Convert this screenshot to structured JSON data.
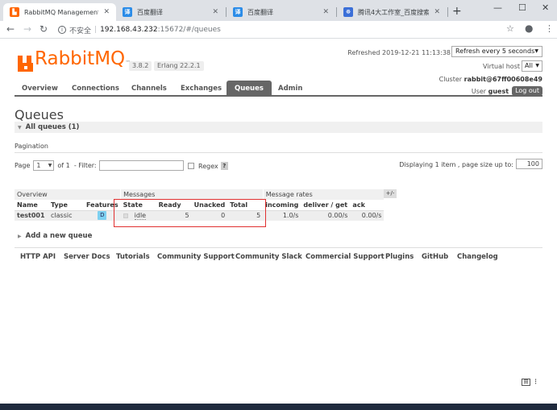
{
  "browser": {
    "tabs": [
      {
        "label": "RabbitMQ Management",
        "favicon": "rabbitmq-icon",
        "favicon_color": "#f60",
        "favicon_text": "▙",
        "active": true
      },
      {
        "label": "百度翻译",
        "favicon": "baidu-translate-icon",
        "favicon_color": "#2b8ce8",
        "favicon_text": "译",
        "active": false
      },
      {
        "label": "百度翻译",
        "favicon": "baidu-translate-icon",
        "favicon_color": "#2b8ce8",
        "favicon_text": "译",
        "active": false
      },
      {
        "label": "腾讯4大工作室_百度搜索",
        "favicon": "baidu-paw-icon",
        "favicon_color": "#3b6fd8",
        "favicon_text": "☸",
        "active": false
      }
    ],
    "url": {
      "security": "不安全",
      "host": "192.168.43.232",
      "rest": ":15672/#/queues"
    }
  },
  "header": {
    "logo_rabbit": "Rabbit",
    "logo_mq": "MQ",
    "logo_tm": "™",
    "version": "3.8.2",
    "erlang": "Erlang 22.2.1",
    "refreshed_label": "Refreshed",
    "refreshed_time": "2019-12-21 11:13:38",
    "refresh_select": "Refresh every 5 seconds",
    "vhost_label": "Virtual host",
    "vhost_value": "All",
    "cluster_label": "Cluster",
    "cluster_value": "rabbit@67ff00608e49",
    "user_label": "User",
    "user_value": "guest",
    "logout": "Log out"
  },
  "nav": {
    "items": [
      "Overview",
      "Connections",
      "Channels",
      "Exchanges",
      "Queues",
      "Admin"
    ],
    "selected": "Queues"
  },
  "main": {
    "title": "Queues",
    "all_queues": "All queues (1)",
    "pagination_label": "Pagination",
    "page_label": "Page",
    "page_value": "1",
    "of_label": "of 1",
    "filter_label": "- Filter:",
    "regex_label": "Regex",
    "help_mark": "?",
    "displaying": "Displaying 1 item , page size up to:",
    "page_size": "100",
    "plus_minus": "+/-",
    "add_queue": "Add a new queue"
  },
  "table": {
    "groups": [
      "Overview",
      "Messages",
      "Message rates"
    ],
    "headers": [
      "Name",
      "Type",
      "Features",
      "State",
      "Ready",
      "Unacked",
      "Total",
      "incoming",
      "deliver / get",
      "ack"
    ],
    "rows": [
      {
        "name": "test001",
        "type": "classic",
        "feature": "D",
        "state": "idle",
        "ready": "5",
        "unacked": "0",
        "total": "5",
        "incoming": "1.0/s",
        "deliver_get": "0.00/s",
        "ack": "0.00/s"
      }
    ],
    "highlight_color": "#e03030"
  },
  "footer": {
    "links": [
      "HTTP API",
      "Server Docs",
      "Tutorials",
      "Community Support",
      "Community Slack",
      "Commercial Support",
      "Plugins",
      "GitHub",
      "Changelog"
    ]
  },
  "colors": {
    "brand": "#f60",
    "nav_selected": "#666666"
  }
}
